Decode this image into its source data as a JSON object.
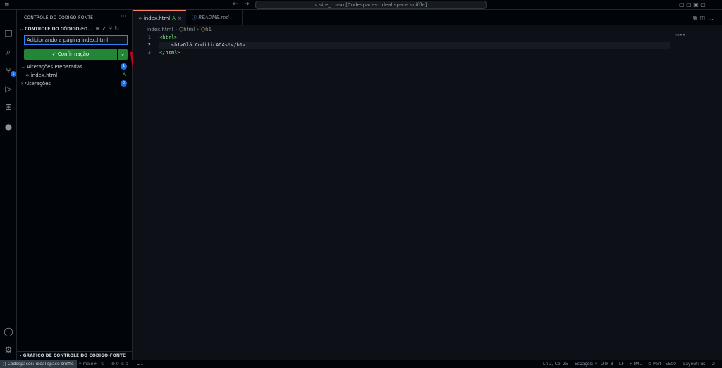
{
  "titlebar": {
    "command_center": "site_curso [Codespaces: ideal space sniffle]",
    "back_icon": "←",
    "forward_icon": "→"
  },
  "activity": [
    "explorer-icon",
    "search-icon",
    "source-control-icon",
    "run-debug-icon",
    "extensions-icon",
    "github-icon",
    "account-icon",
    "settings-icon"
  ],
  "source_control_badge": "1",
  "sidebar": {
    "title": "CONTROLE DO CÓDIGO-FONTE",
    "section": "CONTROLE DO CÓDIGO-FO...",
    "commit_message": "Adicionando a página index.html",
    "commit_button": "✓ Confirmação",
    "staged_label": "Alterações Preparadas",
    "staged_count": "1",
    "staged_file": "index.html",
    "staged_status": "A",
    "changes_label": "Alterações",
    "changes_count": "0",
    "graph_header": "GRÁFICO DE CONTROLE DO CÓDIGO-FONTE"
  },
  "tabs": [
    {
      "label": "index.html",
      "status": "A"
    },
    {
      "label": "README.md"
    }
  ],
  "breadcrumb": [
    "index.html",
    "html",
    "h1"
  ],
  "code": {
    "line_numbers": [
      "1",
      "2",
      "3"
    ],
    "lines": [
      "<html>",
      "    <h1>Olá CodificADAs!</h1>",
      "</html>"
    ]
  },
  "statusbar": {
    "remote": "Codespaces: ideal space sniffle",
    "branch": "main+",
    "problems": "⊗ 0 ⚠ 0",
    "ports_count": "1",
    "position": "Ln 2, Col 25",
    "spaces": "Espaços: 4",
    "encoding": "UTF-8",
    "eol": "LF",
    "language": "HTML",
    "port": "Port : 5500",
    "layout": "Layout: us"
  },
  "colors": {
    "commit_green": "#238636",
    "accent_blue": "#1f6feb",
    "annotation_red": "#d0021b"
  }
}
